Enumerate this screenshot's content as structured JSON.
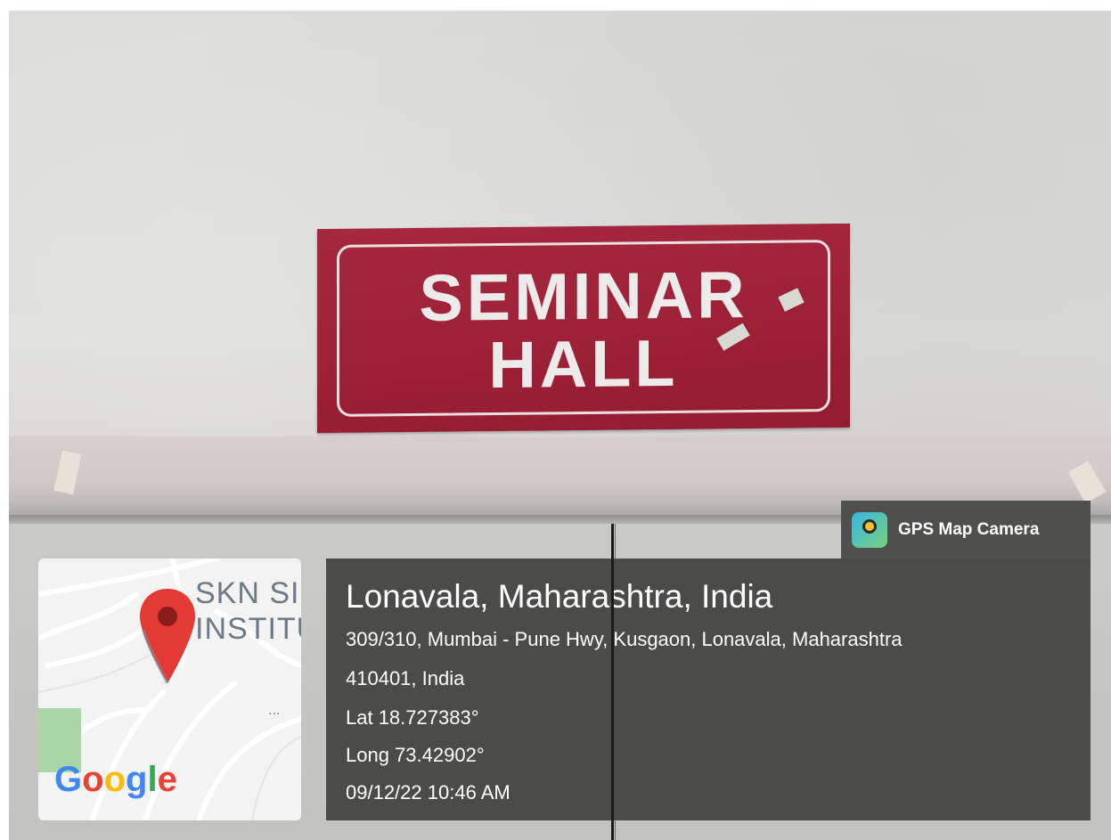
{
  "sign": {
    "line1": "SEMINAR",
    "line2": "HALL"
  },
  "badge": {
    "app_name": "GPS Map Camera",
    "icon": "gps-map-camera-icon"
  },
  "map": {
    "label_line1": "SKN SI",
    "label_line2": "INSTITU",
    "more_dots": "...",
    "logo_text": "Google",
    "pin_icon": "map-pin-icon",
    "colors": {
      "pin": "#e53935",
      "green": "#a9d5a7"
    }
  },
  "location": {
    "title": "Lonavala, Maharashtra, India",
    "address_line1": "309/310, Mumbai - Pune Hwy, Kusgaon, Lonavala, Maharashtra",
    "address_line2": "410401, India",
    "lat": "Lat 18.727383°",
    "long": "Long 73.42902°",
    "datetime": "09/12/22 10:46 AM"
  }
}
